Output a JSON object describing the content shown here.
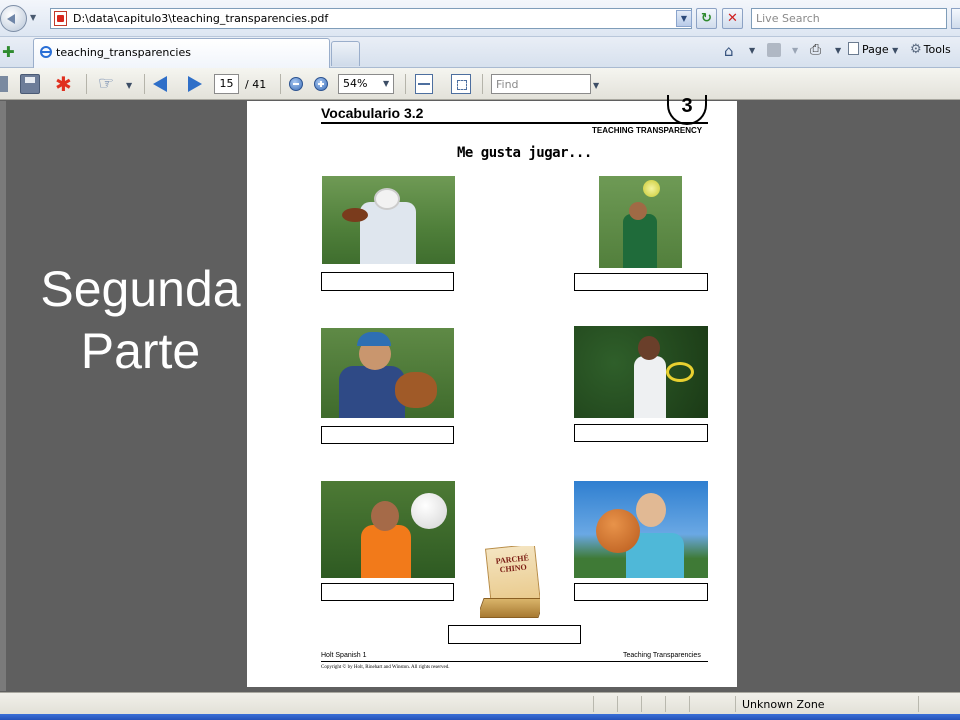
{
  "browser": {
    "address": "D:\\data\\capitulo3\\teaching_transparencies.pdf",
    "search_placeholder": "Live Search",
    "tab_title": "teaching_transparencies",
    "page_menu": "Page",
    "tools_menu": "Tools"
  },
  "pdf_toolbar": {
    "page_current": "15",
    "page_total": "/ 41",
    "zoom": "54%",
    "find_placeholder": "Find"
  },
  "slide": {
    "title_line1": "Segunda",
    "title_line2": "Parte"
  },
  "document": {
    "vocab_title": "Vocabulario 3.2",
    "chapter": "3",
    "section_label": "TEACHING TRANSPARENCY",
    "subtitle": "Me gusta jugar...",
    "game_box_label": "PARCHÉ CHINO",
    "footer_left": "Holt Spanish 1",
    "footer_right": "Teaching Transparencies",
    "copyright": "Copyright © by Holt, Rinehart and Winston. All rights reserved."
  },
  "status": {
    "zone": "Unknown Zone"
  },
  "colors": {
    "doc_background": "#5f5f5f",
    "page": "#ffffff",
    "slide_text": "#ffffff"
  }
}
